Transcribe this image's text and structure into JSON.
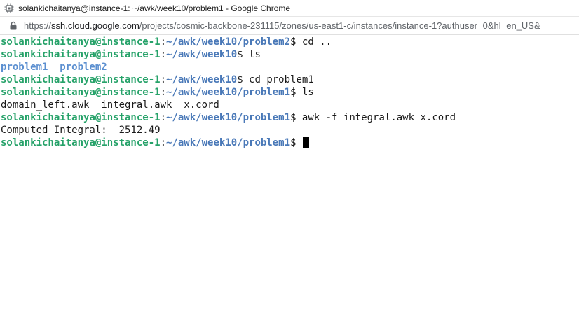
{
  "window": {
    "title": "solankichaitanya@instance-1: ~/awk/week10/problem1 - Google Chrome",
    "icon": "terminal-chip-icon"
  },
  "address": {
    "scheme": "https://",
    "domain": "ssh.cloud.google.com",
    "rest": "/projects/cosmic-backbone-231115/zones/us-east1-c/instances/instance-1?authuser=0&hl=en_US&",
    "lock_icon": "lock-icon"
  },
  "terminal": {
    "user_color": "#26a269",
    "path_color": "#4a79b8",
    "lines": [
      {
        "user": "solankichaitanya@instance-1",
        "sep": ":",
        "path": "~/awk/week10/problem2",
        "cmd": "$ cd .."
      },
      {
        "user": "solankichaitanya@instance-1",
        "sep": ":",
        "path": "~/awk/week10",
        "cmd": "$ ls"
      },
      {
        "dirs": "problem1  problem2"
      },
      {
        "user": "solankichaitanya@instance-1",
        "sep": ":",
        "path": "~/awk/week10",
        "cmd": "$ cd problem1"
      },
      {
        "user": "solankichaitanya@instance-1",
        "sep": ":",
        "path": "~/awk/week10/problem1",
        "cmd": "$ ls"
      },
      {
        "text": "domain_left.awk  integral.awk  x.cord"
      },
      {
        "user": "solankichaitanya@instance-1",
        "sep": ":",
        "path": "~/awk/week10/problem1",
        "cmd": "$ awk -f integral.awk x.cord"
      },
      {
        "text": "Computed Integral:  2512.49"
      },
      {
        "user": "solankichaitanya@instance-1",
        "sep": ":",
        "path": "~/awk/week10/problem1",
        "cmd": "$ "
      }
    ]
  }
}
